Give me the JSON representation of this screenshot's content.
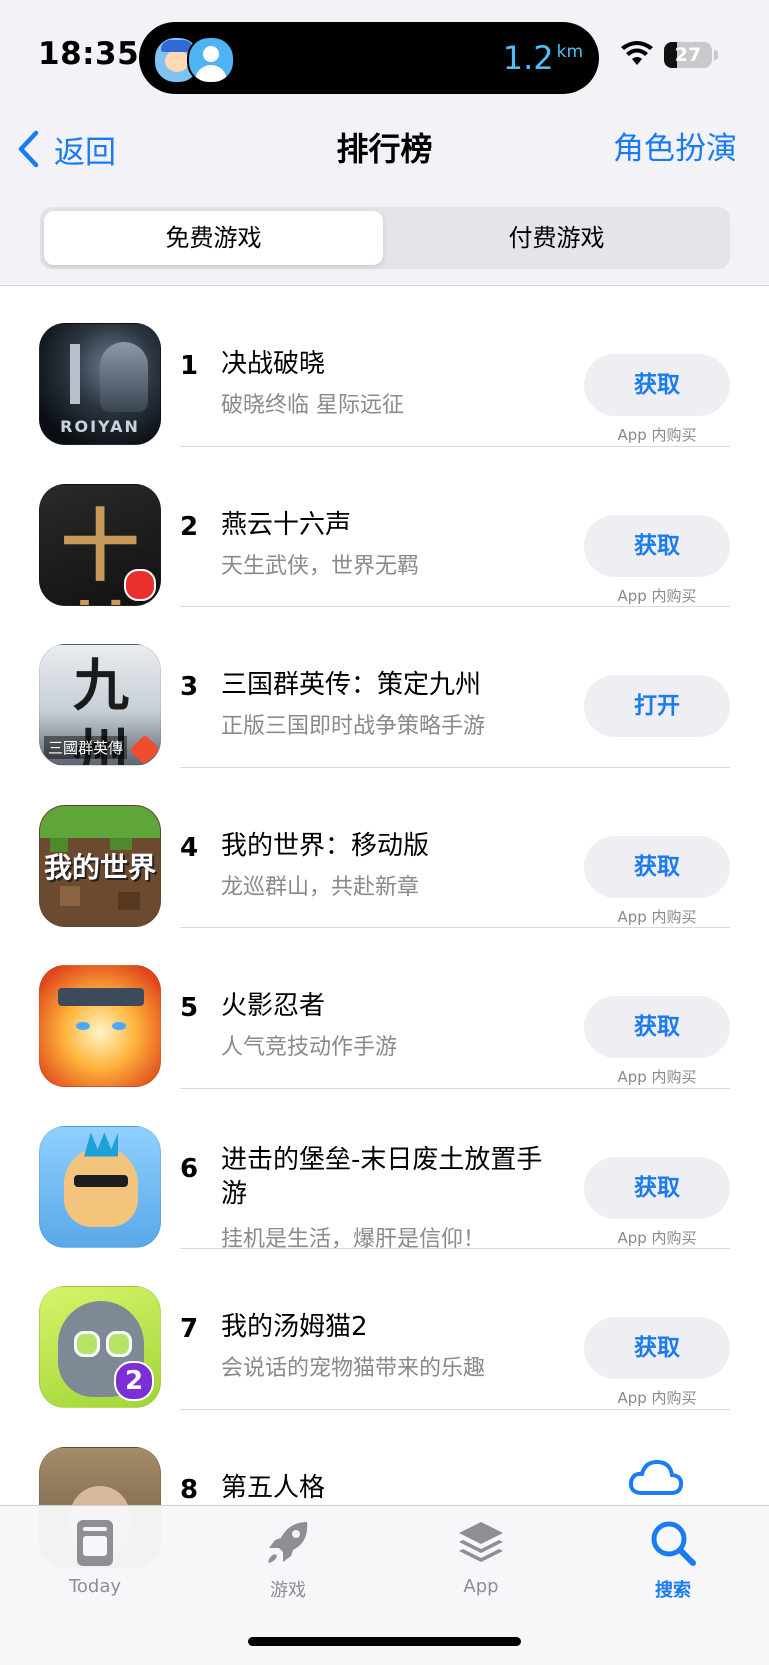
{
  "status_bar": {
    "time": "18:35",
    "distance_value": "1.2",
    "distance_unit": "km",
    "battery": "27",
    "battery_level": 0.27
  },
  "nav": {
    "back_label": "返回",
    "title": "排行榜",
    "right_label": "角色扮演"
  },
  "segments": {
    "free_label": "免费游戏",
    "paid_label": "付费游戏",
    "selected": "免费游戏"
  },
  "apps": [
    {
      "rank": "1",
      "title": "决战破晓",
      "subtitle": "破晓终临 星际远征",
      "action": "获取",
      "iap": "App 内购买",
      "icon": "game-icon-1",
      "brand": "ROIYAN"
    },
    {
      "rank": "2",
      "title": "燕云十六声",
      "subtitle": "天生武侠，世界无羁",
      "action": "获取",
      "iap": "App 内购买",
      "icon": "game-icon-2",
      "glyph": "十廾"
    },
    {
      "rank": "3",
      "title": "三国群英传：策定九州",
      "subtitle": "正版三国即时战争策略手游",
      "action": "打开",
      "iap": "",
      "icon": "game-icon-3",
      "glyph": "九州",
      "icon_sub": "三國群英傳"
    },
    {
      "rank": "4",
      "title": "我的世界：移动版",
      "subtitle": "龙巡群山，共赴新章",
      "action": "获取",
      "iap": "App 内购买",
      "icon": "game-icon-4",
      "glyph": "我的世界"
    },
    {
      "rank": "5",
      "title": "火影忍者",
      "subtitle": "人气竞技动作手游",
      "action": "获取",
      "iap": "App 内购买",
      "icon": "game-icon-5"
    },
    {
      "rank": "6",
      "title": "进击的堡垒-末日废土放置手游",
      "subtitle": "挂机是生活，爆肝是信仰！",
      "action": "获取",
      "iap": "App 内购买",
      "icon": "game-icon-6"
    },
    {
      "rank": "7",
      "title": "我的汤姆猫2",
      "subtitle": "会说话的宠物猫带来的乐趣",
      "action": "获取",
      "iap": "App 内购买",
      "icon": "game-icon-7",
      "badge": "2"
    },
    {
      "rank": "8",
      "title": "第五人格",
      "subtitle": "",
      "action": "download-cloud-icon",
      "iap": "",
      "icon": "game-icon-8"
    }
  ],
  "tabbar": {
    "tabs": [
      {
        "label": "Today",
        "icon": "today-icon"
      },
      {
        "label": "游戏",
        "icon": "rocket-icon"
      },
      {
        "label": "App",
        "icon": "stack-icon"
      },
      {
        "label": "搜索",
        "icon": "search-icon"
      }
    ],
    "active": "搜索"
  },
  "colors": {
    "accent": "#1a7cf5",
    "header_bg": "#f2f2f7",
    "secondary_text": "#8a8a8e",
    "button_bg": "#eeeef3"
  }
}
